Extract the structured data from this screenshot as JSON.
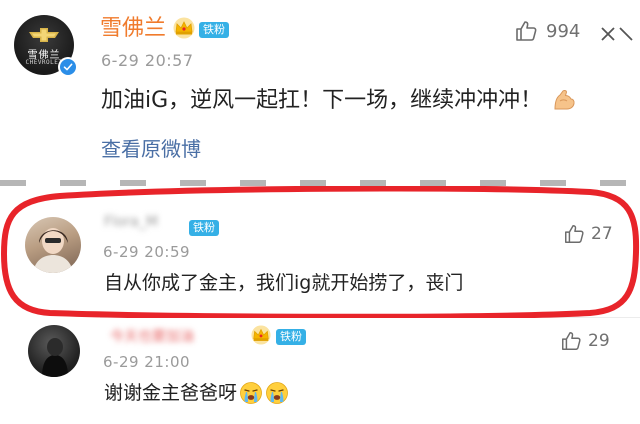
{
  "post": {
    "author": "雪佛兰",
    "avatar_brand_cn": "雪佛兰",
    "avatar_brand_en": "CHEVROLET",
    "badge": "铁粉",
    "timestamp": "6-29 20:57",
    "likes": "994",
    "text": "加油iG，逆风一起扛！下一场，继续冲冲冲！",
    "text_emoji": "flexed-biceps-icon",
    "view_original": "查看原微博"
  },
  "comments": [
    {
      "username_blurred": "Flora_M",
      "badge": "铁粉",
      "timestamp": "6-29 20:59",
      "likes": "27",
      "text": "自从你成了金主，我们ig就开始捞了，丧门"
    },
    {
      "username_blurred": "今天也要加油",
      "badge": "铁粉",
      "timestamp": "6-29 21:00",
      "likes": "29",
      "text": "谢谢金主爸爸呀",
      "emojis": [
        "crying-face-icon",
        "crying-face-icon"
      ]
    }
  ],
  "colors": {
    "author_orange": "#f07b2c",
    "badge_blue": "#35b0e6",
    "link_blue": "#4a6fa5",
    "highlight_red": "#e8242a",
    "crown_gold": "#f5b400"
  }
}
